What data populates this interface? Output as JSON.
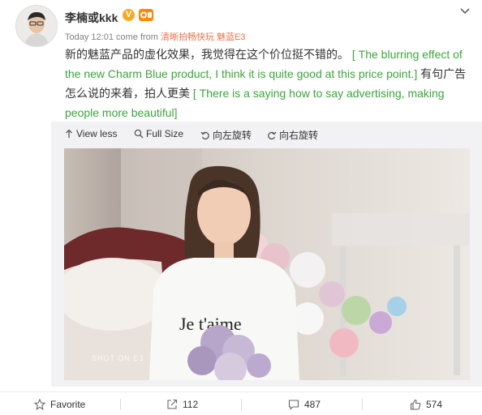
{
  "post": {
    "username": "李楠或kkk",
    "verified_badge": "V",
    "time": "Today 12:01",
    "come_from": "come from",
    "source": "清晰拍畅快玩 魅蓝E3",
    "text_cn_1": "新的魅蓝产品的虚化效果，我觉得在这个价位挺不错的。",
    "text_en_1": "[ The blurring effect of the new Charm Blue product, I think it is quite good at this price point.]",
    "text_cn_2": "有句广告怎么说的来着，拍人更美",
    "text_en_2": "[ There is a saying how to say advertising, making people more beautiful]"
  },
  "toolbar": {
    "view_less": "View less",
    "full_size": "Full Size",
    "rotate_left": "向左旋转",
    "rotate_right": "向右旋转"
  },
  "photo": {
    "watermark": "SHOT ON E3",
    "shirt_text": "Je t'aime"
  },
  "actions": {
    "favorite": "Favorite",
    "repost_count": "112",
    "comment_count": "487",
    "like_count": "574"
  },
  "colors": {
    "translation_green": "#3ba53b",
    "source_link": "#eb7350",
    "verified_gold": "#f9a825"
  },
  "icons": [
    "chevron-down-icon",
    "arrow-up-icon",
    "search-icon",
    "rotate-left-icon",
    "rotate-right-icon",
    "star-icon",
    "repost-icon",
    "comment-icon",
    "thumbs-up-icon"
  ]
}
